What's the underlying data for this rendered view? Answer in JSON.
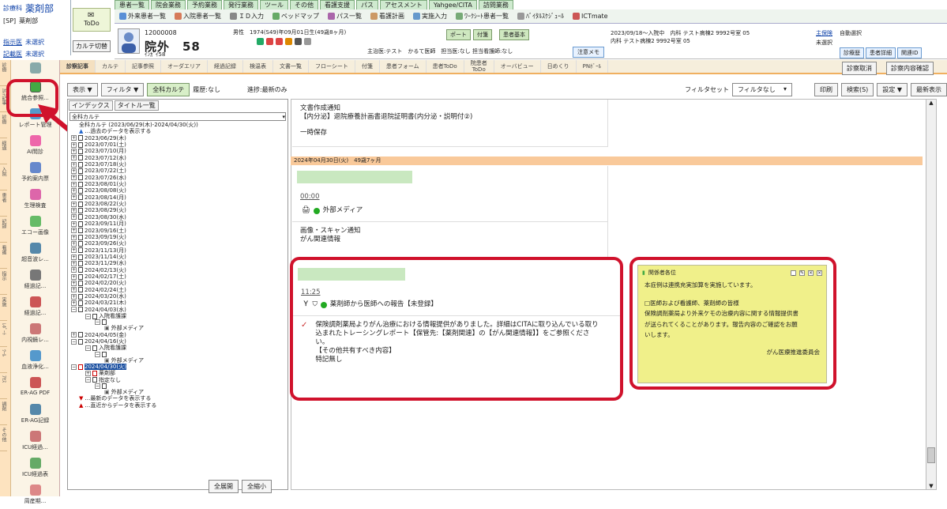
{
  "topleft": {
    "dept": "診療科",
    "dept2": "[SP]",
    "dept_val": "薬剤部",
    "dept_sub": "薬剤部",
    "doc": "指示医",
    "doc_val": "未選択",
    "rec": "記載医",
    "rec_val": "未選択"
  },
  "todo": "ToDo",
  "karte_switch": "カルテ切替",
  "menu_tabs": [
    "患者一覧",
    "院会業務",
    "予約業務",
    "発行業務",
    "ツール",
    "その他",
    "看護支援",
    "パス",
    "アセスメント",
    "Yahgee/CITA",
    "訪問業務"
  ],
  "toolbar": [
    "外来患者一覧",
    "入院患者一覧",
    "ＩＤ入力",
    "ベッドマップ",
    "パス一覧",
    "看護計画",
    "実施入力",
    "ﾜｰｸｼｰﾄ患者一覧",
    "ﾊﾞｲﾀﾙｽｹｼﾞｭｰﾙ",
    "ICTmate"
  ],
  "patient": {
    "id": "12000008",
    "name": "院外　58",
    "kana": "ｲﾝｶﾞｲ58",
    "info": "男性　1974(S49)年09月01日生(49歳8ヶ月)",
    "doctor": "主治医:テスト　かるて医師　担当医:なし 担当看護師:なし",
    "btn1": "ポート",
    "btn2": "付箋",
    "btn3": "患者基本",
    "admit": "2023/09/18～入院中　内科 テスト病棟2 9992号室 05",
    "ward": "内科 テスト病棟2 9992号室 05",
    "memo": "注意メモ",
    "ins": "主保険",
    "ins_val": "自動選択",
    "unsel": "未選択",
    "links": [
      "診療歴",
      "患者詳細",
      "関連ID"
    ]
  },
  "tabs": [
    "診察記事",
    "カルテ",
    "記事参照",
    "オーダエリア",
    "経過記録",
    "検温表",
    "文書一覧",
    "フローシート",
    "付箋",
    "患者フォーム",
    "患者ToDo",
    "院患者\nToDo",
    "オーバビュー",
    "日めくり",
    "PNﾎﾞｰﾙ"
  ],
  "tab_right": [
    "診察取消",
    "診察内容確認"
  ],
  "side_tabs": [
    "診療",
    "ｶﾙﾃ記事",
    "診療",
    "経過",
    "入院",
    "患者",
    "記録",
    "看護",
    "指示",
    "実施",
    "ﾚﾎﾟｰﾄ",
    "ﾂｰﾙ",
    "ｱｾｽ",
    "調剤",
    "その他"
  ],
  "side_items": [
    "統合参照...",
    "レポート管理",
    "AI問診",
    "予約案内票",
    "生理検査",
    "エコー画像",
    "超音波レ...",
    "経過記...",
    "経過記...",
    "内視鏡レ...",
    "血液浄化...",
    "ER-AG PDF",
    "ER-AG記録",
    "ICU経過...",
    "ICU経過表",
    "周産期..."
  ],
  "filter": {
    "show": "表示",
    "filter": "フィルタ",
    "all": "全科カルテ",
    "history": "履歴:なし",
    "progress": "進捗:最新のみ",
    "preset_label": "フィルタセット",
    "preset_val": "フィルタなし",
    "print": "印刷",
    "search": "検索(S)",
    "settings": "設定",
    "latest": "最新表示"
  },
  "tree": {
    "tab1": "インデックス",
    "tab2": "タイトル一覧",
    "select": "全科カルテ",
    "root": "全科カルテ (2023/06/29(木)-2024/04/30(火))",
    "past": "…過去のデータを表示する",
    "dates": [
      "2023/06/29(木)",
      "2023/07/01(土)",
      "2023/07/10(月)",
      "2023/07/12(水)",
      "2023/07/18(火)",
      "2023/07/22(土)",
      "2023/07/26(水)",
      "2023/08/01(火)",
      "2023/08/08(火)",
      "2023/08/14(月)",
      "2023/08/22(火)",
      "2023/08/29(火)",
      "2023/08/30(水)",
      "2023/09/11(月)",
      "2023/09/16(土)",
      "2023/09/19(火)",
      "2023/09/26(火)",
      "2023/11/13(月)",
      "2023/11/14(火)",
      "2023/11/29(水)",
      "2024/02/13(火)",
      "2024/02/17(土)",
      "2024/02/20(火)",
      "2024/02/24(土)",
      "2024/03/20(水)",
      "2024/03/21(木)",
      "2024/04/03(水)"
    ],
    "n1": "入院看護課",
    "n1b": "外部メディア",
    "d2": "2024/04/05(金)",
    "d3": "2024/04/16(火)",
    "n2": "入院看護課",
    "n2b": "外部メディア",
    "d4": "2024/04/30(火)",
    "n3": "薬剤部",
    "n4": "指定なし",
    "n4b": "外部メディア",
    "latest": "…最新のデータを表示する",
    "direct": "…直近からデータを表示する",
    "btn_expand": "全展開",
    "btn_collapse": "全縮小"
  },
  "main": {
    "doc_title": "文書作成通知",
    "doc_sub": "【内分泌】退院療養計画書退院証明書(内分泌・説明付②)",
    "doc_save": "一時保存",
    "date": "2024年04月30日(火)　49歳7ヶ月",
    "time1": "00:00",
    "media": "外部メディア",
    "scan": "画像・スキャン通知",
    "scan2": "がん関連情報",
    "time2": "11:25",
    "report": "薬剤師から医師への報告【未登録】",
    "body": "保険調剤薬局よりがん治療における情報提供がありました。詳細はCITAに取り込んでいる取り込まれたトレーシングレポート【保管先:【薬剤関連】の【がん関連情報】】をご参照ください。\n【その他共有すべき内容】\n特記無し"
  },
  "note": {
    "title": "関係者各位",
    "l1": "本症例は連携充実加算を実施しています。",
    "l2": "□医師および看護師、薬剤師の皆様",
    "l3": "保険調剤薬局より外来ケモの治療内容に関する情報提供書",
    "l4": "が送られてくることがあります。報告内容のご確認をお願",
    "l5": "いします。",
    "sign": "がん医療推進委員会"
  },
  "colors": {
    "accent": "#d0122c",
    "note": "#f0f08a",
    "date_bar": "#f9c99a"
  }
}
